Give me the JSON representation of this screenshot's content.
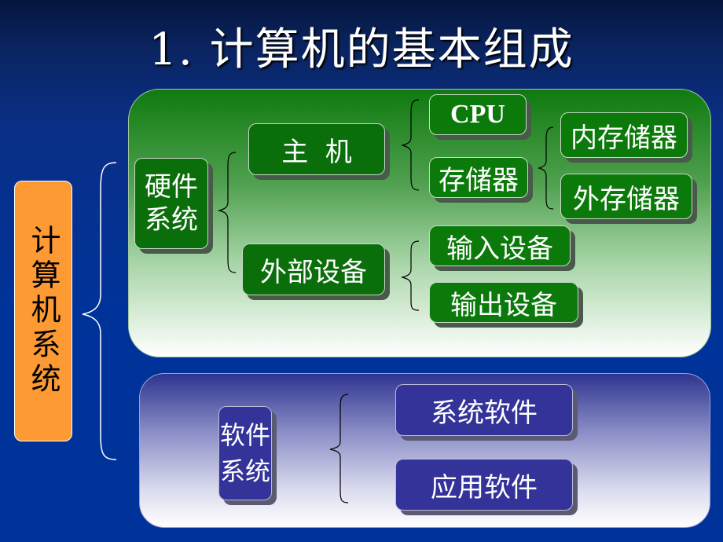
{
  "title": "1. 计算机的基本组成",
  "root": {
    "label": "计算机系统"
  },
  "hardware": {
    "label_line1": "硬件",
    "label_line2": "系统",
    "host": {
      "label": "主  机",
      "children": [
        "CPU",
        "存储器"
      ]
    },
    "memory": {
      "children": [
        "内存储器",
        "外存储器"
      ]
    },
    "peripherals": {
      "label": "外部设备",
      "children": [
        "输入设备",
        "输出设备"
      ]
    }
  },
  "software": {
    "label_line1": "软件",
    "label_line2": "系统",
    "children": [
      "系统软件",
      "应用软件"
    ]
  },
  "colors": {
    "background": "#00339a",
    "root_box": "#fd9a33",
    "hardware_box": "#0a6e0a",
    "software_box": "#33339a"
  }
}
